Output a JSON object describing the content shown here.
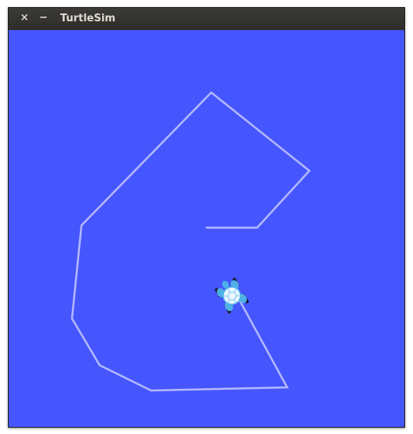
{
  "window": {
    "title": "TurtleSim",
    "close_glyph": "×",
    "minimize_glyph": "−"
  },
  "canvas": {
    "background_color": "#4556ff",
    "pen_color": "#b3b8ff"
  },
  "turtle": {
    "icon": "turtle-icon",
    "shell_color": "#e8f6ff",
    "flipper_color": "#4fb0e8",
    "foot_color": "#1b1b2e"
  }
}
